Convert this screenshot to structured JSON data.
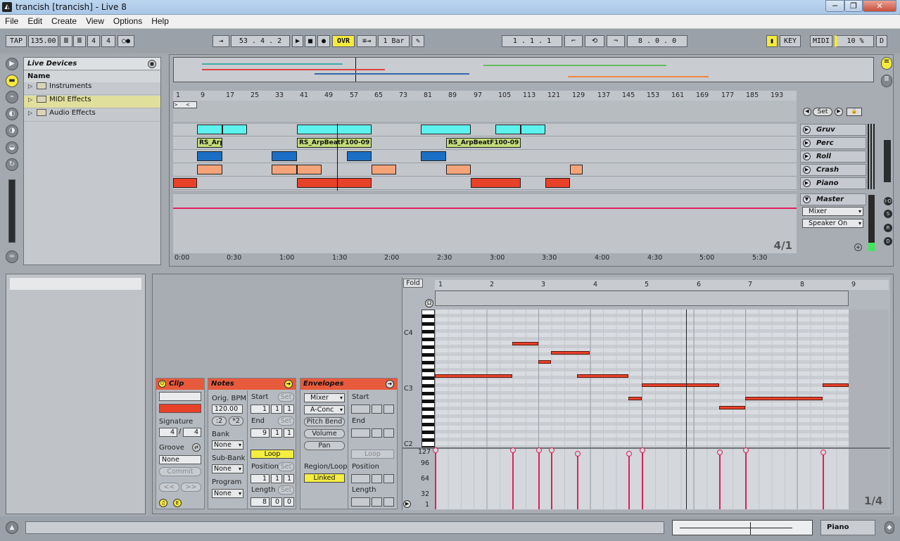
{
  "window": {
    "title": "trancish  [trancish] - Live 8",
    "min": "─",
    "max": "❐",
    "close": "✕"
  },
  "menu": [
    "File",
    "Edit",
    "Create",
    "View",
    "Options",
    "Help"
  ],
  "transport": {
    "tap": "TAP",
    "tempo": "135.00",
    "signature_num": "4",
    "signature_den": "4",
    "position": "53 .   4 .   2",
    "ovr": "OVR",
    "quantize": "1 Bar",
    "loop_start": "1 .   1 .   1",
    "loop_length": "8 .   0 .   0",
    "key": "KEY",
    "midi": "MIDI",
    "cpu": "10 %",
    "d": "D"
  },
  "browser": {
    "title": "Live Devices",
    "column": "Name",
    "items": [
      "Instruments",
      "MIDI Effects",
      "Audio Effects"
    ]
  },
  "ruler": [
    "1",
    "9",
    "17",
    "25",
    "33",
    "41",
    "49",
    "57",
    "65",
    "73",
    "81",
    "89",
    "97",
    "105",
    "113",
    "121",
    "129",
    "137",
    "145",
    "153",
    "161",
    "169",
    "177",
    "185",
    "193"
  ],
  "timeline": [
    "0:00",
    "0:30",
    "1:00",
    "1:30",
    "2:00",
    "2:30",
    "3:00",
    "3:30",
    "4:00",
    "4:30",
    "5:00",
    "5:30"
  ],
  "tracks": [
    "Gruv",
    "Perc",
    "Roll",
    "Crash",
    "Piano"
  ],
  "clip_names": {
    "c1": "RS_Arp",
    "c2": "RS_ArpBeatF100-09",
    "c3": "RS_ArpBeatF100-09"
  },
  "master": {
    "name": "Master",
    "mixer": "Mixer",
    "speaker": "Speaker On",
    "set": "Set",
    "zoom": "4/1"
  },
  "clip_box": {
    "title": "Clip",
    "signature_label": "Signature",
    "sig_num": "4",
    "sig_den": "4",
    "groove_label": "Groove",
    "groove": "None",
    "commit": "Commit",
    "prev": "<<",
    "next": ">>"
  },
  "notes_box": {
    "title": "Notes",
    "bpm_label": "Orig. BPM",
    "bpm": "120.00",
    "half": ":2",
    "double": "*2",
    "bank_label": "Bank",
    "bank": "None",
    "subbank_label": "Sub-Bank",
    "subbank": "None",
    "program_label": "Program",
    "program": "None",
    "start_label": "Start",
    "set": "Set",
    "start": [
      "1",
      "1",
      "1"
    ],
    "end_label": "End",
    "end": [
      "9",
      "1",
      "1"
    ],
    "loop": "Loop",
    "position_label": "Position",
    "position": [
      "1",
      "1",
      "1"
    ],
    "length_label": "Length",
    "length": [
      "8",
      "0",
      "0"
    ]
  },
  "env_box": {
    "title": "Envelopes",
    "device": "Mixer",
    "control": "A-Conc",
    "pitch": "Pitch Bend",
    "volume": "Volume",
    "pan": "Pan",
    "region": "Region/Loop",
    "linked": "Linked",
    "start_label": "Start",
    "end_label": "End",
    "loop": "Loop",
    "position_label": "Position",
    "length_label": "Length"
  },
  "pianoroll": {
    "fold": "Fold",
    "bars": [
      "1",
      "2",
      "3",
      "4",
      "5",
      "6",
      "7",
      "8",
      "9"
    ],
    "keys": [
      "C4",
      "C3",
      "C2"
    ],
    "vel_labels": [
      "127",
      "96",
      "64",
      "32",
      "1"
    ],
    "zoom": "1/4"
  },
  "status": {
    "instrument": "Piano"
  },
  "colors": {
    "accent_orange": "#e85a3c",
    "clip_cyan": "#5ef2ee",
    "clip_blue": "#1a6fc4",
    "clip_salmon": "#f5a47a",
    "clip_red": "#e8412a",
    "clip_green": "#c4dc7a",
    "yellow": "#f6ea3c"
  }
}
